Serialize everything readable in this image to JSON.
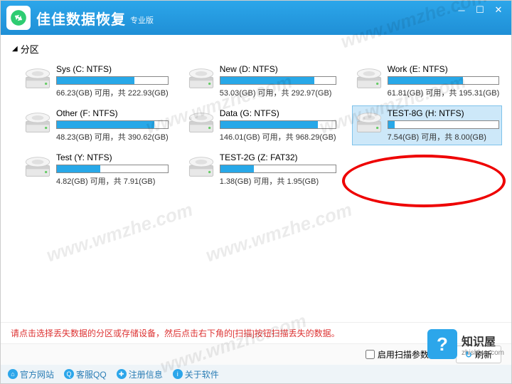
{
  "app": {
    "title": "佳佳数据恢复",
    "subtitle": "专业版"
  },
  "section": {
    "label": "分区"
  },
  "drives": [
    {
      "name": "Sys (C: NTFS)",
      "free": "66.23(GB)",
      "total": "222.93(GB)",
      "used_pct": 70
    },
    {
      "name": "New (D: NTFS)",
      "free": "53.03(GB)",
      "total": "292.97(GB)",
      "used_pct": 82
    },
    {
      "name": "Work (E: NTFS)",
      "free": "61.81(GB)",
      "total": "195.31(GB)",
      "used_pct": 68
    },
    {
      "name": "Other (F: NTFS)",
      "free": "48.23(GB)",
      "total": "390.62(GB)",
      "used_pct": 88
    },
    {
      "name": "Data (G: NTFS)",
      "free": "146.01(GB)",
      "total": "968.29(GB)",
      "used_pct": 85
    },
    {
      "name": "TEST-8G (H: NTFS)",
      "free": "7.54(GB)",
      "total": "8.00(GB)",
      "used_pct": 6,
      "selected": true
    },
    {
      "name": "Test (Y: NTFS)",
      "free": "4.82(GB)",
      "total": "7.91(GB)",
      "used_pct": 39
    },
    {
      "name": "TEST-2G (Z: FAT32)",
      "free": "1.38(GB)",
      "total": "1.95(GB)",
      "used_pct": 29
    }
  ],
  "usage_template": {
    "free_label": " 可用，共 "
  },
  "hint": "请点击选择丢失数据的分区或存储设备，然后点击右下角的[扫描]按钮扫描丢失的数据。",
  "actions": {
    "enable_scan_params": "启用扫描参数设置",
    "refresh": "刷新"
  },
  "footer": {
    "site": "官方网站",
    "qq": "客服QQ",
    "reg": "注册信息",
    "about": "关于软件"
  },
  "watermark": "www.wmzhe.com",
  "brand": {
    "name": "知识屋",
    "url": "zhishiwu.com"
  }
}
